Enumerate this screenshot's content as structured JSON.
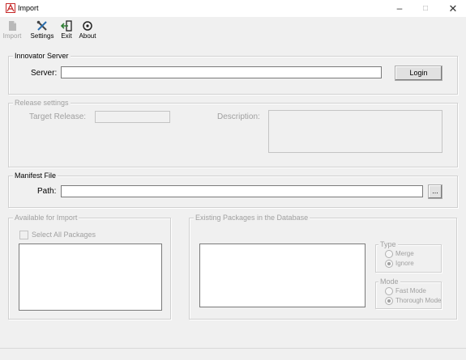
{
  "window": {
    "title": "Import",
    "minimize": "–",
    "maximize": "□",
    "close": "✕"
  },
  "toolbar": {
    "import_label": "Import",
    "settings_label": "Settings",
    "exit_label": "Exit",
    "about_label": "About"
  },
  "innovator_server": {
    "group_title": "Innovator Server",
    "server_label": "Server:",
    "server_value": "",
    "login_label": "Login"
  },
  "release_settings": {
    "group_title": "Release settings",
    "target_release_label": "Target Release:",
    "target_release_value": "",
    "description_label": "Description:",
    "description_value": ""
  },
  "manifest_file": {
    "group_title": "Manifest File",
    "path_label": "Path:",
    "path_value": "",
    "browse_label": "..."
  },
  "available_for_import": {
    "group_title": "Available for Import",
    "select_all_label": "Select All Packages",
    "select_all_checked": false
  },
  "existing_packages": {
    "group_title": "Existing Packages in the Database",
    "type": {
      "group_title": "Type",
      "merge_label": "Merge",
      "ignore_label": "Ignore",
      "selected": "Ignore"
    },
    "mode": {
      "group_title": "Mode",
      "fast_label": "Fast Mode",
      "thorough_label": "Thorough Mode",
      "selected": "Thorough Mode"
    }
  },
  "colors": {
    "background": "#f0f0f0",
    "disabled_text": "#a0a0a0",
    "app_icon": "#c62828"
  }
}
